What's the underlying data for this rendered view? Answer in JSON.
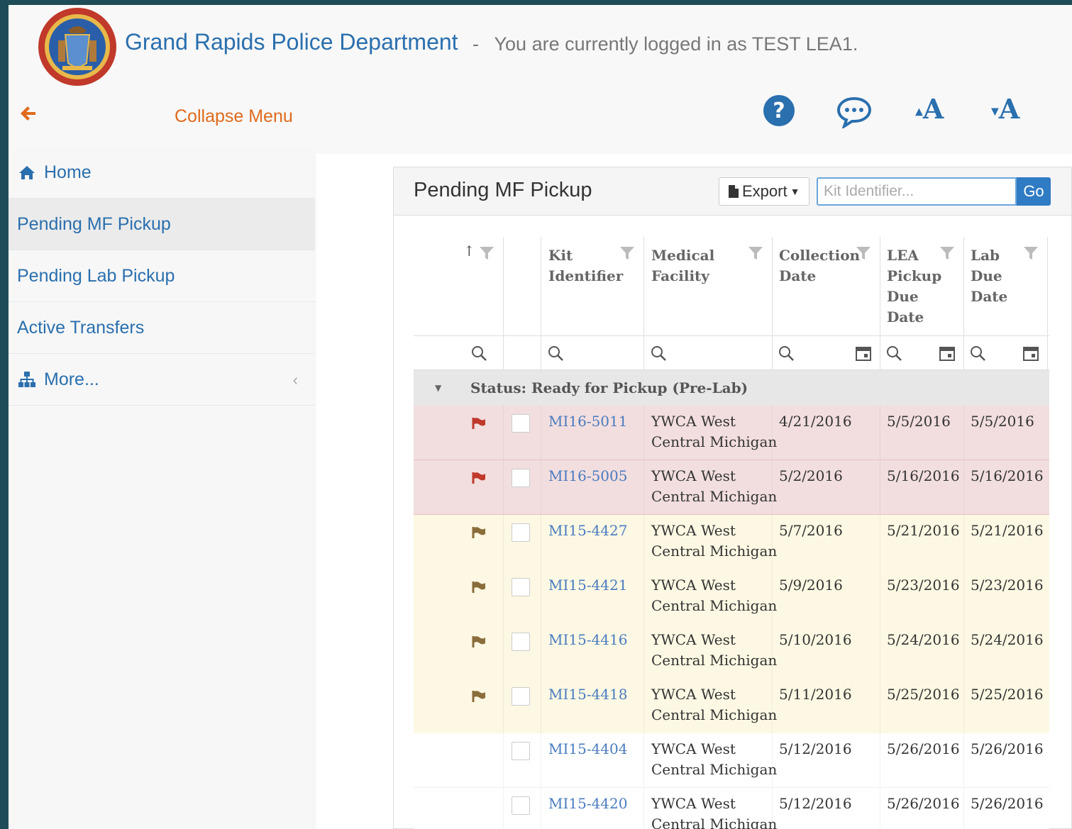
{
  "header": {
    "org_name": "Grand Rapids Police Department",
    "separator": "-",
    "login_text": "You are currently logged in as TEST LEA1.",
    "collapse_label": "Collapse Menu"
  },
  "toolbar": {
    "icons": [
      "help-icon",
      "chat-icon",
      "increase-font-icon",
      "decrease-font-icon"
    ],
    "font_up_label": "A",
    "font_down_label": "A"
  },
  "sidebar": {
    "items": [
      {
        "label": "Home",
        "icon": "home-icon"
      },
      {
        "label": "Pending MF Pickup",
        "active": true
      },
      {
        "label": "Pending Lab Pickup"
      },
      {
        "label": "Active Transfers"
      },
      {
        "label": "More...",
        "icon": "sitemap-icon"
      }
    ]
  },
  "panel": {
    "title": "Pending MF Pickup",
    "export_label": "Export",
    "search_placeholder": "Kit Identifier...",
    "go_label": "Go"
  },
  "grid": {
    "sort_indicator": "↑",
    "columns": [
      {
        "line1": "Kit",
        "line2": "Identifier"
      },
      {
        "line1": "Medical",
        "line2": "Facility"
      },
      {
        "line1": "Collection",
        "line2": "Date"
      },
      {
        "line1": "LEA",
        "line2": "Pickup",
        "line3": "Due",
        "line4": "Date"
      },
      {
        "line1": "Lab",
        "line2": "Due",
        "line3": "Date"
      }
    ],
    "group_label": "Status: Ready for Pickup (Pre-Lab)",
    "rows": [
      {
        "kit": "MI16-5011",
        "fac1": "YWCA West",
        "fac2": "Central Michigan",
        "collection": "4/21/2016",
        "lea_due": "5/5/2016",
        "lab_due": "5/5/2016",
        "status": "red",
        "flag": "#c0392b"
      },
      {
        "kit": "MI16-5005",
        "fac1": "YWCA West",
        "fac2": "Central Michigan",
        "collection": "5/2/2016",
        "lea_due": "5/16/2016",
        "lab_due": "5/16/2016",
        "status": "red",
        "flag": "#c0392b"
      },
      {
        "kit": "MI15-4427",
        "fac1": "YWCA West",
        "fac2": "Central Michigan",
        "collection": "5/7/2016",
        "lea_due": "5/21/2016",
        "lab_due": "5/21/2016",
        "status": "yellow",
        "flag": "#8a6d3b"
      },
      {
        "kit": "MI15-4421",
        "fac1": "YWCA West",
        "fac2": "Central Michigan",
        "collection": "5/9/2016",
        "lea_due": "5/23/2016",
        "lab_due": "5/23/2016",
        "status": "yellow",
        "flag": "#8a6d3b"
      },
      {
        "kit": "MI15-4416",
        "fac1": "YWCA West",
        "fac2": "Central Michigan",
        "collection": "5/10/2016",
        "lea_due": "5/24/2016",
        "lab_due": "5/24/2016",
        "status": "yellow",
        "flag": "#8a6d3b"
      },
      {
        "kit": "MI15-4418",
        "fac1": "YWCA West",
        "fac2": "Central Michigan",
        "collection": "5/11/2016",
        "lea_due": "5/25/2016",
        "lab_due": "5/25/2016",
        "status": "yellow",
        "flag": "#8a6d3b"
      },
      {
        "kit": "MI15-4404",
        "fac1": "YWCA West",
        "fac2": "Central Michigan",
        "collection": "5/12/2016",
        "lea_due": "5/26/2016",
        "lab_due": "5/26/2016",
        "status": "white"
      },
      {
        "kit": "MI15-4420",
        "fac1": "YWCA West",
        "fac2": "Central Michigan",
        "collection": "5/12/2016",
        "lea_due": "5/26/2016",
        "lab_due": "5/26/2016",
        "status": "white"
      }
    ]
  },
  "colors": {
    "brand_blue": "#2a6fae",
    "accent_orange": "#e06a1c",
    "row_overdue": "#f2dede",
    "row_warning": "#fcf8e3",
    "flag_red": "#c0392b",
    "flag_brown": "#8a6d3b"
  }
}
